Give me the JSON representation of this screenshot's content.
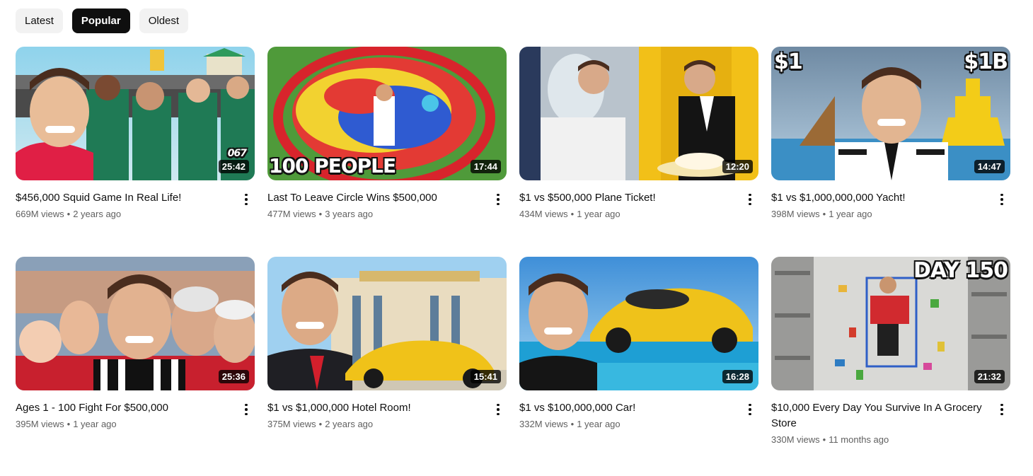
{
  "filters": {
    "chips": [
      "Latest",
      "Popular",
      "Oldest"
    ],
    "active": "Popular"
  },
  "videos": [
    {
      "title": "$456,000 Squid Game In Real Life!",
      "views": "669M views",
      "age": "2 years ago",
      "duration": "25:42",
      "overlay": "",
      "overlay2": "",
      "overlay3": "067"
    },
    {
      "title": "Last To Leave Circle Wins $500,000",
      "views": "477M views",
      "age": "3 years ago",
      "duration": "17:44",
      "overlay": "100 PEOPLE",
      "overlay2": "",
      "overlay3": ""
    },
    {
      "title": "$1 vs $500,000 Plane Ticket!",
      "views": "434M views",
      "age": "1 year ago",
      "duration": "12:20",
      "overlay": "",
      "overlay2": "",
      "overlay3": ""
    },
    {
      "title": "$1 vs $1,000,000,000 Yacht!",
      "views": "398M views",
      "age": "1 year ago",
      "duration": "14:47",
      "overlay": "$1",
      "overlay2": "$1B",
      "overlay3": ""
    },
    {
      "title": "Ages 1 - 100 Fight For $500,000",
      "views": "395M views",
      "age": "1 year ago",
      "duration": "25:36",
      "overlay": "",
      "overlay2": "",
      "overlay3": ""
    },
    {
      "title": "$1 vs $1,000,000 Hotel Room!",
      "views": "375M views",
      "age": "2 years ago",
      "duration": "15:41",
      "overlay": "",
      "overlay2": "",
      "overlay3": ""
    },
    {
      "title": "$1 vs $100,000,000 Car!",
      "views": "332M views",
      "age": "1 year ago",
      "duration": "16:28",
      "overlay": "",
      "overlay2": "",
      "overlay3": ""
    },
    {
      "title": "$10,000 Every Day You Survive In A Grocery Store",
      "views": "330M views",
      "age": "11 months ago",
      "duration": "21:32",
      "overlay": "DAY 150",
      "overlay2": "",
      "overlay3": ""
    }
  ],
  "separator": "•",
  "icons": {
    "more": "more-vert-icon"
  }
}
